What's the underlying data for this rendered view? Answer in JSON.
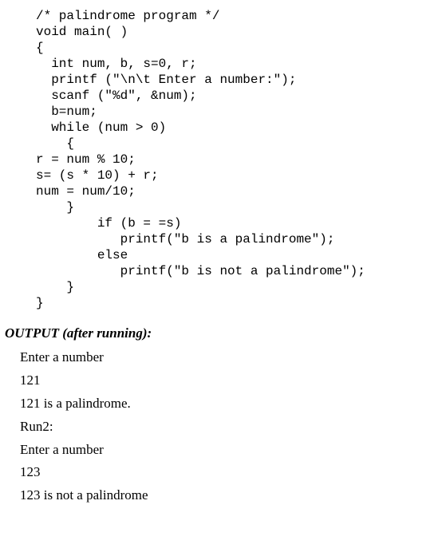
{
  "code": "/* palindrome program */\nvoid main( )\n{\n  int num, b, s=0, r;\n  printf (\"\\n\\t Enter a number:\");\n  scanf (\"%d\", &num);\n  b=num;\n  while (num > 0)\n    {\nr = num % 10;\ns= (s * 10) + r;\nnum = num/10;\n    }\n        if (b = =s)\n           printf(\"b is a palindrome\");\n        else\n           printf(\"b is not a palindrome\");\n    }\n}",
  "output_heading": "OUTPUT (after running):",
  "output_lines": [
    "Enter a number",
    "121",
    "121 is a palindrome.",
    "Run2:",
    "Enter a number",
    "123",
    "123 is not a palindrome"
  ]
}
